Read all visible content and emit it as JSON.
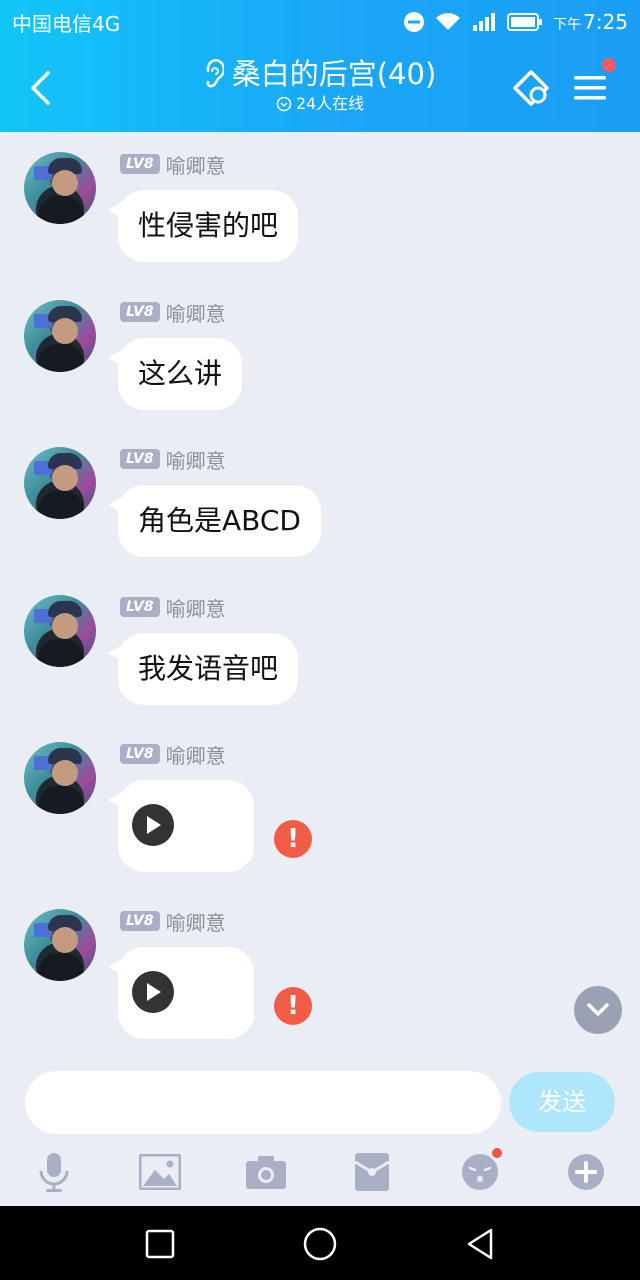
{
  "status_bar": {
    "carrier": "中国电信4G",
    "time_prefix": "下午",
    "time": "7:25"
  },
  "header": {
    "title": "桑白的后宫(40)",
    "online": "24人在线",
    "icons": [
      "back-chevron-icon",
      "ear-icon",
      "ticket-icon",
      "menu-icon"
    ]
  },
  "messages": [
    {
      "level": "LV8",
      "sender": "喻卿意",
      "text": "性侵害的吧"
    },
    {
      "level": "LV8",
      "sender": "喻卿意",
      "text": "这么讲"
    },
    {
      "level": "LV8",
      "sender": "喻卿意",
      "text": "角色是ABCD"
    },
    {
      "level": "LV8",
      "sender": "喻卿意",
      "text": "我发语音吧"
    },
    {
      "level": "LV8",
      "sender": "喻卿意",
      "type": "voice",
      "failed": true,
      "error_mark": "!"
    },
    {
      "level": "LV8",
      "sender": "喻卿意",
      "type": "voice",
      "failed": true,
      "error_mark": "!"
    }
  ],
  "composer": {
    "input_value": "",
    "send_label": "发送"
  },
  "toolbar": {
    "items": [
      "microphone-icon",
      "image-icon",
      "camera-icon",
      "red-packet-icon",
      "emoji-icon",
      "plus-icon"
    ]
  },
  "colors": {
    "header_start": "#11c6f8",
    "header_end": "#1b9ef6",
    "background": "#eaedf4",
    "send_button": "#aee7fb",
    "error": "#f25b45",
    "badge_dot": "#f45a64"
  }
}
